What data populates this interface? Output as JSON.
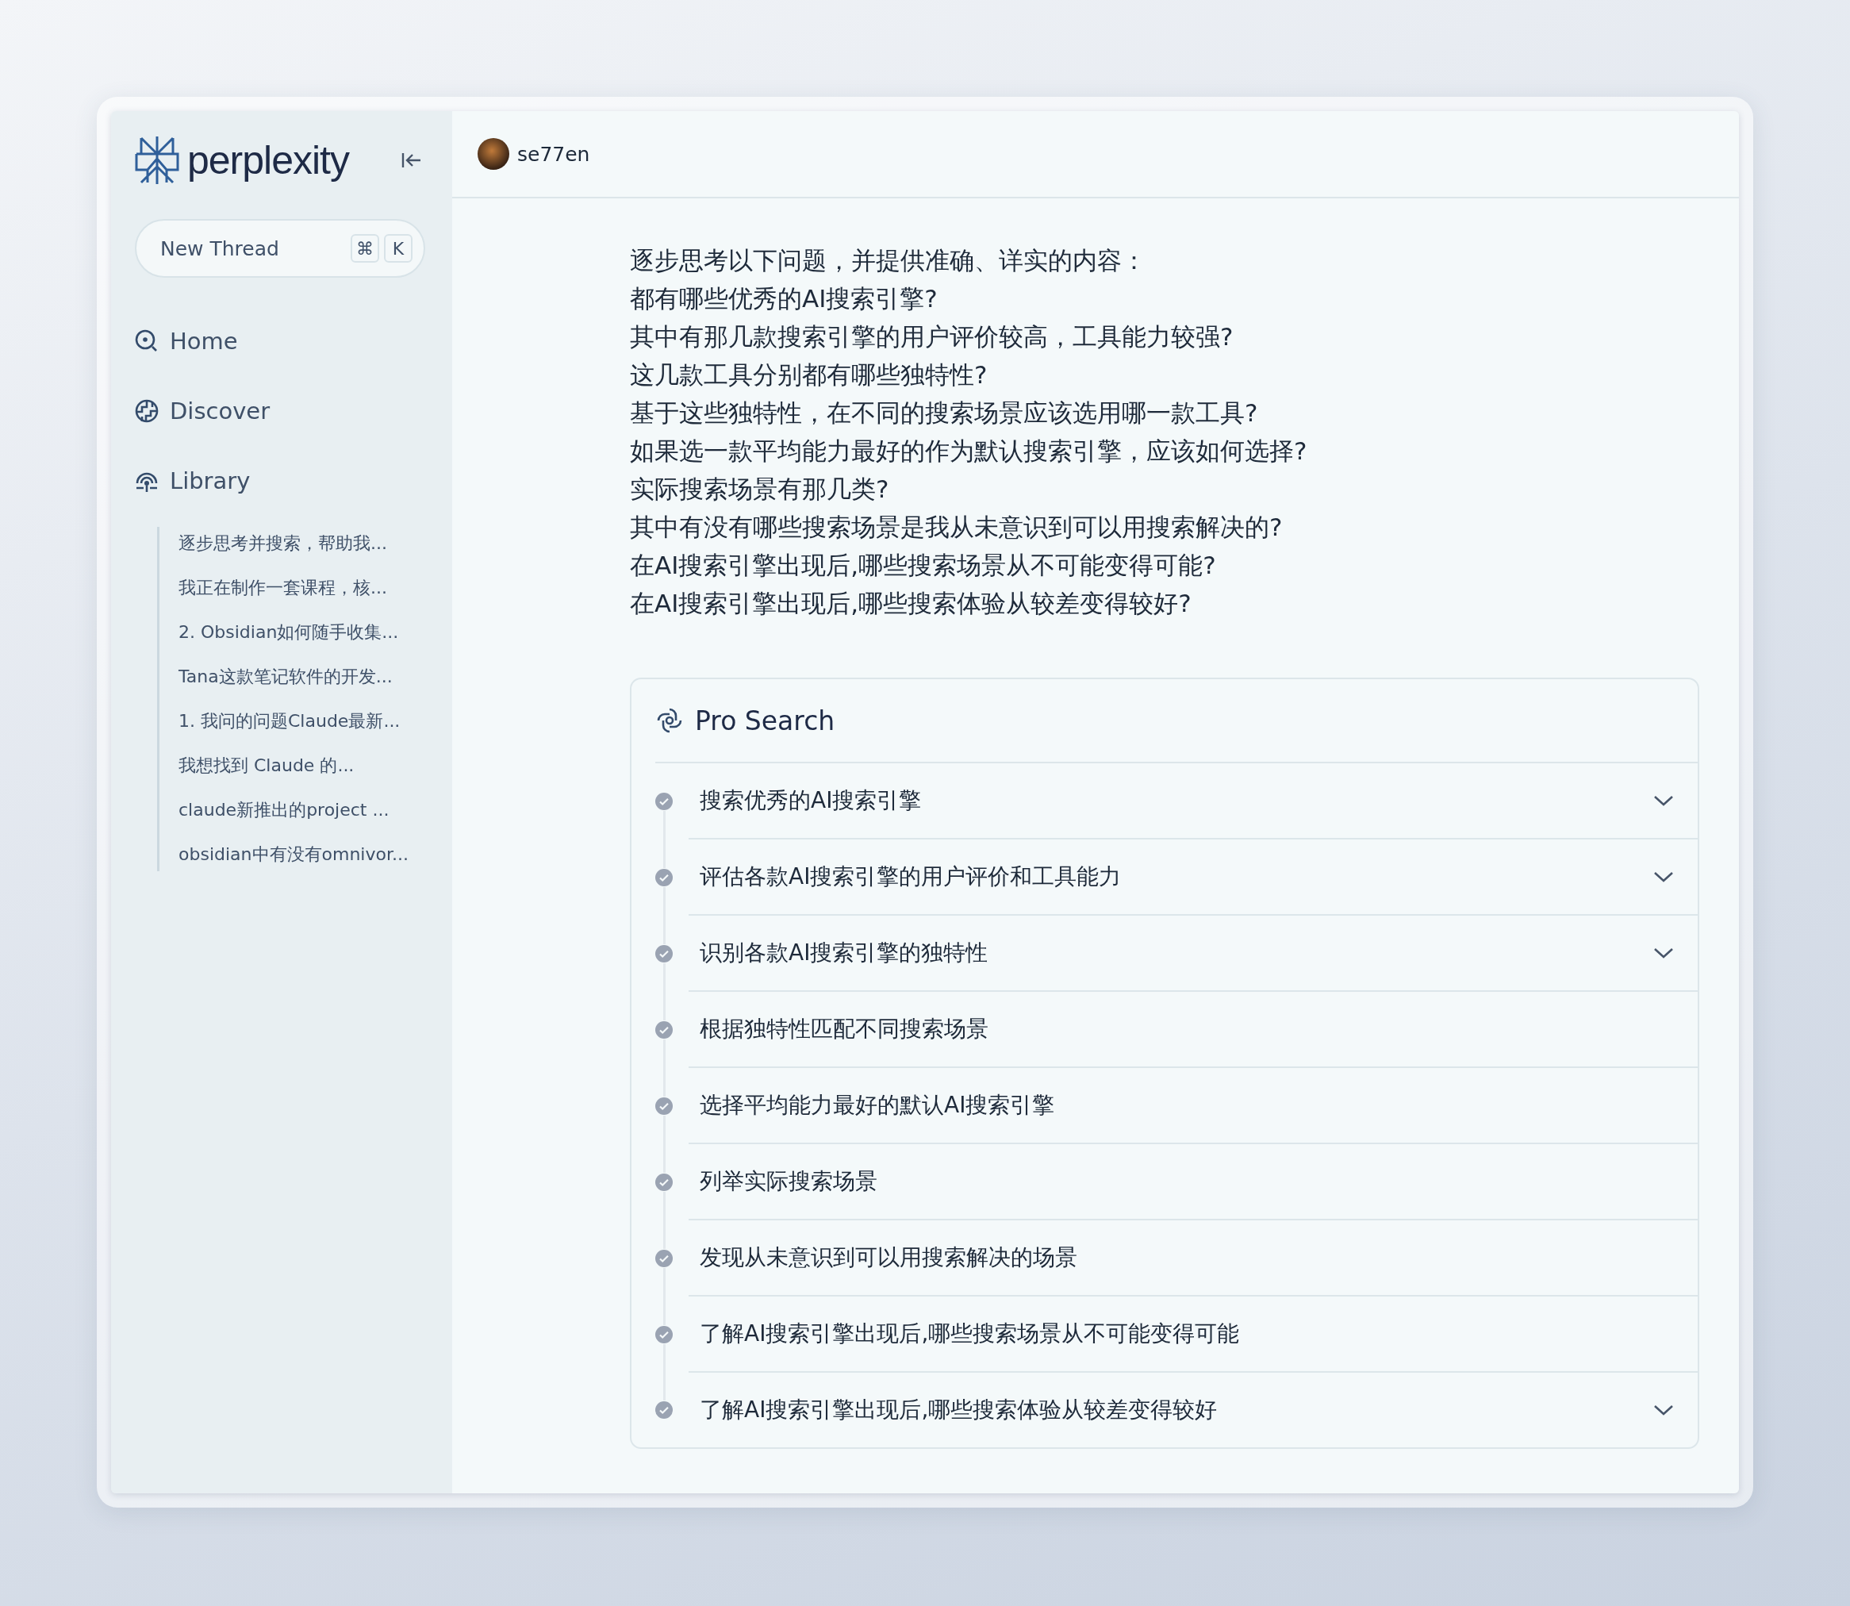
{
  "sidebar": {
    "logo_text": "perplexity",
    "new_thread": {
      "label": "New Thread",
      "keys": [
        "⌘",
        "K"
      ]
    },
    "nav": [
      {
        "label": "Home"
      },
      {
        "label": "Discover"
      },
      {
        "label": "Library"
      }
    ],
    "library_items": [
      "逐步思考并搜索，帮助我...",
      "我正在制作一套课程，核...",
      "2. Obsidian如何随手收集...",
      "Tana这款笔记软件的开发...",
      "1. 我问的问题Claude最新...",
      "我想找到 Claude 的...",
      "claude新推出的project  ...",
      "obsidian中有没有omnivor..."
    ]
  },
  "header": {
    "user": "se77en"
  },
  "question": [
    "逐步思考以下问题，并提供准确、详实的内容：",
    "都有哪些优秀的AI搜索引擎?",
    "其中有那几款搜索引擎的用户评价较高，工具能力较强?",
    "这几款工具分别都有哪些独特性?",
    "基于这些独特性，在不同的搜索场景应该选用哪一款工具?",
    "如果选一款平均能力最好的作为默认搜索引擎，应该如何选择?",
    "实际搜索场景有那几类?",
    "其中有没有哪些搜索场景是我从未意识到可以用搜索解决的?",
    "在AI搜索引擎出现后,哪些搜索场景从不可能变得可能?",
    "在AI搜索引擎出现后,哪些搜索体验从较差变得较好?"
  ],
  "pro_search": {
    "title": "Pro Search",
    "steps": [
      {
        "label": "搜索优秀的AI搜索引擎",
        "done": true,
        "expandable": true
      },
      {
        "label": "评估各款AI搜索引擎的用户评价和工具能力",
        "done": true,
        "expandable": true
      },
      {
        "label": "识别各款AI搜索引擎的独特性",
        "done": true,
        "expandable": true
      },
      {
        "label": "根据独特性匹配不同搜索场景",
        "done": true,
        "expandable": false
      },
      {
        "label": "选择平均能力最好的默认AI搜索引擎",
        "done": true,
        "expandable": false
      },
      {
        "label": "列举实际搜索场景",
        "done": true,
        "expandable": false
      },
      {
        "label": "发现从未意识到可以用搜索解决的场景",
        "done": true,
        "expandable": false
      },
      {
        "label": "了解AI搜索引擎出现后,哪些搜索场景从不可能变得可能",
        "done": true,
        "expandable": false
      },
      {
        "label": "了解AI搜索引擎出现后,哪些搜索体验从较差变得较好",
        "done": true,
        "expandable": true
      }
    ]
  }
}
